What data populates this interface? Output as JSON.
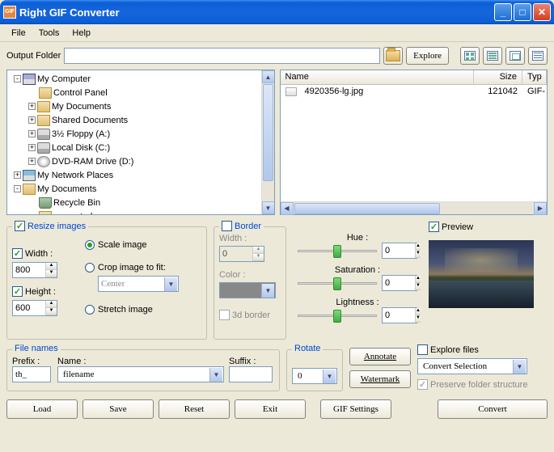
{
  "window": {
    "title": "Right GIF Converter"
  },
  "menu": {
    "file": "File",
    "tools": "Tools",
    "help": "Help"
  },
  "toolbar": {
    "output_folder_label": "Output Folder",
    "explore": "Explore"
  },
  "tree": {
    "items": [
      {
        "label": "My Computer",
        "icon": "computer",
        "indent": 0,
        "exp": "-"
      },
      {
        "label": "Control Panel",
        "icon": "folder",
        "indent": 1,
        "exp": ""
      },
      {
        "label": "My Documents",
        "icon": "folder",
        "indent": 1,
        "exp": "+"
      },
      {
        "label": "Shared Documents",
        "icon": "folder",
        "indent": 1,
        "exp": "+"
      },
      {
        "label": "3½ Floppy (A:)",
        "icon": "drive",
        "indent": 1,
        "exp": "+"
      },
      {
        "label": "Local Disk (C:)",
        "icon": "drive",
        "indent": 1,
        "exp": "+"
      },
      {
        "label": "DVD-RAM Drive (D:)",
        "icon": "cd",
        "indent": 1,
        "exp": "+"
      },
      {
        "label": "My Network Places",
        "icon": "network",
        "indent": 0,
        "exp": "+"
      },
      {
        "label": "My Documents",
        "icon": "folder",
        "indent": 0,
        "exp": "-"
      },
      {
        "label": "Recycle Bin",
        "icon": "bin",
        "indent": 1,
        "exp": ""
      },
      {
        "label": "converted",
        "icon": "folder",
        "indent": 1,
        "exp": ""
      }
    ]
  },
  "list": {
    "headers": {
      "name": "Name",
      "size": "Size",
      "type": "Typ"
    },
    "rows": [
      {
        "name": "4920356-lg.jpg",
        "size": "121042",
        "type": "GIF-"
      }
    ]
  },
  "resize": {
    "title": "Resize images",
    "width_label": "Width :",
    "width_value": "800",
    "height_label": "Height :",
    "height_value": "600",
    "scale": "Scale image",
    "crop": "Crop image to fit:",
    "crop_pos": "Center",
    "stretch": "Stretch image"
  },
  "border": {
    "title": "Border",
    "width_label": "Width :",
    "width_value": "0",
    "color_label": "Color :",
    "threed": "3d border"
  },
  "adjust": {
    "hue": "Hue :",
    "hue_v": "0",
    "sat": "Saturation :",
    "sat_v": "0",
    "light": "Lightness :",
    "light_v": "0"
  },
  "preview": {
    "title": "Preview"
  },
  "filenames": {
    "title": "File names",
    "prefix_label": "Prefix :",
    "prefix_value": "th_",
    "name_label": "Name :",
    "name_value": "filename",
    "suffix_label": "Suffix :",
    "suffix_value": ""
  },
  "rotate": {
    "title": "Rotate",
    "value": "0"
  },
  "side": {
    "annotate": "Annotate",
    "watermark": "Watermark",
    "explore_files": "Explore files",
    "convert_sel": "Convert Selection",
    "preserve": "Preserve folder structure"
  },
  "buttons": {
    "load": "Load",
    "save": "Save",
    "reset": "Reset",
    "exit": "Exit",
    "gif_settings": "GIF Settings",
    "convert": "Convert"
  }
}
